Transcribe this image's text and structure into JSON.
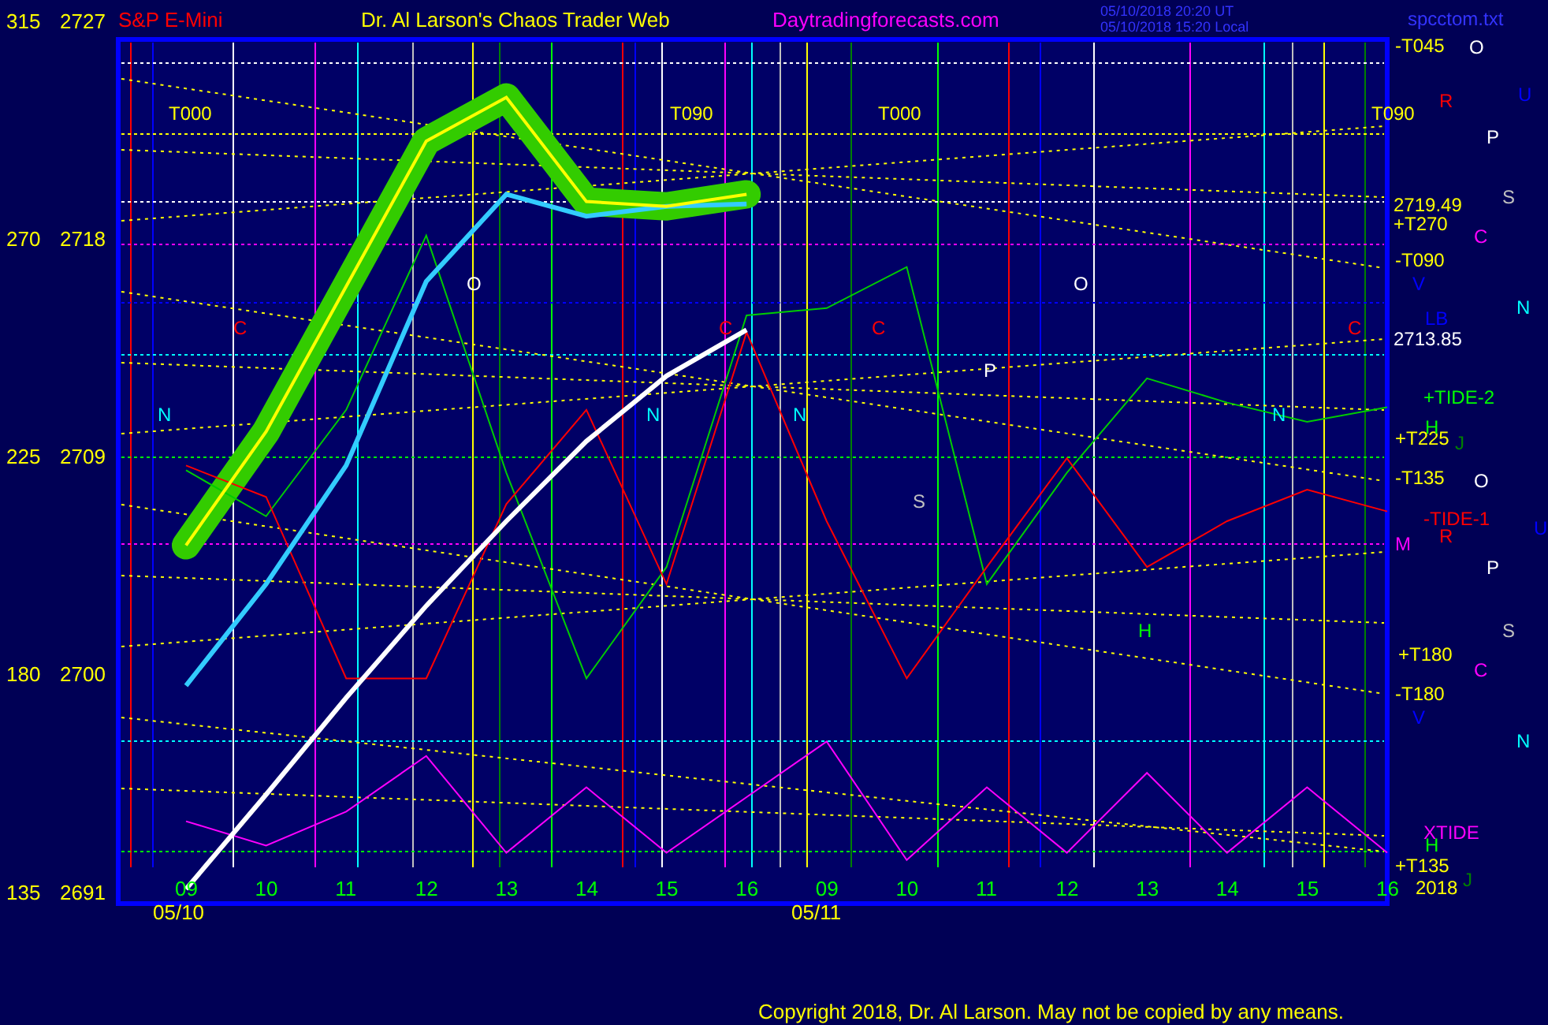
{
  "header": {
    "symbol": "S&P E-Mini",
    "title": "Dr. Al Larson's Chaos Trader Web",
    "site": "Daytradingforecasts.com",
    "timestamps": [
      "05/10/2018 20:20 UT",
      "05/10/2018 15:20 Local"
    ],
    "file": "spcctom.txt"
  },
  "top_scale": {
    "scale": "315",
    "price": "2727"
  },
  "chart": {
    "left_scale": [
      "270",
      "225",
      "180",
      "135"
    ],
    "chart_data": {
      "type": "line",
      "categories": [
        "09",
        "10",
        "11",
        "12",
        "13",
        "14",
        "15",
        "16",
        "09",
        "10",
        "11",
        "12",
        "13",
        "14",
        "15",
        "16"
      ],
      "ylim": [
        2690.5,
        2726.2
      ],
      "yticks": [
        2718,
        2709,
        2700,
        2691
      ],
      "series": [
        {
          "color": "#ffff00",
          "values": [
            2705.3,
            2710.0,
            2716.0,
            2722.0,
            2723.8,
            2719.5,
            2719.3,
            2719.8,
            null,
            null,
            null,
            null,
            null,
            null,
            null,
            null
          ]
        },
        {
          "color": "#33ccff",
          "values": [
            2699.5,
            2703.7,
            2708.6,
            2716.2,
            2719.8,
            2718.9,
            2719.3,
            2719.4,
            null,
            null,
            null,
            null,
            null,
            null,
            null,
            null
          ]
        },
        {
          "color": "#ffffff",
          "values": [
            2691.1,
            2695.0,
            2699.0,
            2702.8,
            2706.3,
            2709.6,
            2712.3,
            2714.2,
            null,
            null,
            null,
            null,
            null,
            null,
            null,
            null
          ]
        },
        {
          "color": "#00cc00",
          "values": [
            2708.4,
            2706.5,
            2710.9,
            2718.1,
            2708.3,
            2699.8,
            2704.4,
            2714.8,
            2715.1,
            2716.8,
            2703.7,
            2708.3,
            2712.2,
            2711.2,
            2710.4,
            2711.0
          ]
        },
        {
          "color": "#ff0000",
          "values": [
            2708.6,
            2707.3,
            2699.8,
            2699.8,
            2707.0,
            2710.9,
            2703.7,
            2714.1,
            2706.3,
            2699.8,
            2704.4,
            2708.9,
            2704.4,
            2706.3,
            2707.6,
            2706.7
          ]
        },
        {
          "color": "#ff00ff",
          "values": [
            2693.9,
            2692.9,
            2694.3,
            2696.6,
            2692.6,
            2695.3,
            2692.6,
            2694.9,
            2697.2,
            2692.3,
            2695.3,
            2692.6,
            2695.9,
            2692.6,
            2695.3,
            2692.6
          ]
        }
      ]
    },
    "dates": [
      "05/10",
      "05/11"
    ],
    "labels": [
      {
        "text": "T000",
        "color": "#ffff00"
      },
      {
        "text": "T090",
        "color": "#ffff00"
      },
      {
        "text": "T000",
        "color": "#ffff00"
      },
      {
        "text": "T090",
        "color": "#ffff00"
      },
      {
        "text": "O",
        "color": "#ffffff"
      },
      {
        "text": "O",
        "color": "#ffffff"
      },
      {
        "text": "C",
        "color": "#ff0000"
      },
      {
        "text": "C",
        "color": "#ff0000"
      },
      {
        "text": "C",
        "color": "#ff0000"
      },
      {
        "text": "C",
        "color": "#ff0000"
      },
      {
        "text": "P",
        "color": "#ffffff"
      },
      {
        "text": "N",
        "color": "#00ffff"
      },
      {
        "text": "N",
        "color": "#00ffff"
      },
      {
        "text": "N",
        "color": "#00ffff"
      },
      {
        "text": "N",
        "color": "#00ffff"
      },
      {
        "text": "S",
        "color": "#c0c0c0"
      },
      {
        "text": "H",
        "color": "#00ff00"
      },
      {
        "text": "-T045",
        "color": "#ffff00"
      },
      {
        "text": "2719.49",
        "color": "#ffff00"
      },
      {
        "text": "+T270",
        "color": "#ffff00"
      },
      {
        "text": "-T090",
        "color": "#ffff00"
      },
      {
        "text": "2713.85",
        "color": "#ffffff"
      },
      {
        "text": "+TIDE-2",
        "color": "#00ff00"
      },
      {
        "text": "+T225",
        "color": "#ffff00"
      },
      {
        "text": "-T135",
        "color": "#ffff00"
      },
      {
        "text": "-TIDE-1",
        "color": "#ff0000"
      },
      {
        "text": "M",
        "color": "#ff00ff"
      },
      {
        "text": "+T180",
        "color": "#ffff00"
      },
      {
        "text": "-T180",
        "color": "#ffff00"
      },
      {
        "text": "XTIDE",
        "color": "#ff00ff"
      },
      {
        "text": "+T135",
        "color": "#ffff00"
      },
      {
        "text": "2018",
        "color": "#ffff00"
      },
      {
        "text": "O",
        "color": "#ffffff"
      },
      {
        "text": "U",
        "color": "#0000ff"
      },
      {
        "text": "R",
        "color": "#ff0000"
      },
      {
        "text": "P",
        "color": "#ffffff"
      },
      {
        "text": "S",
        "color": "#c0c0c0"
      },
      {
        "text": "C",
        "color": "#ff00ff"
      },
      {
        "text": "V",
        "color": "#0000ff"
      },
      {
        "text": "N",
        "color": "#00ffff"
      },
      {
        "text": "LB",
        "color": "#0000ff"
      },
      {
        "text": "H",
        "color": "#00ff00"
      },
      {
        "text": "J",
        "color": "#008000"
      },
      {
        "text": "O",
        "color": "#ffffff"
      },
      {
        "text": "R",
        "color": "#ff0000"
      },
      {
        "text": "U",
        "color": "#0000ff"
      },
      {
        "text": "P",
        "color": "#ffffff"
      },
      {
        "text": "S",
        "color": "#c0c0c0"
      },
      {
        "text": "C",
        "color": "#ff00ff"
      },
      {
        "text": "V",
        "color": "#0000ff"
      },
      {
        "text": "N",
        "color": "#00ffff"
      },
      {
        "text": "H",
        "color": "#00ff00"
      },
      {
        "text": "J",
        "color": "#008000"
      }
    ]
  },
  "footer": {
    "copyright": "Copyright 2018, Dr. Al Larson. May not be copied by any means."
  }
}
